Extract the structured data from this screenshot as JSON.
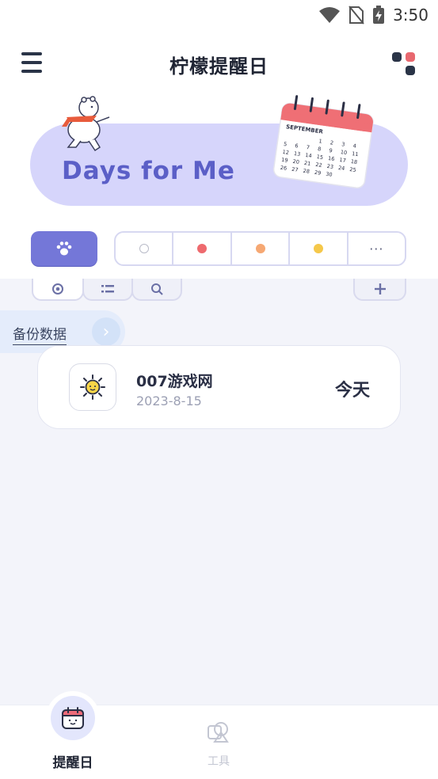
{
  "status_bar": {
    "time": "3:50"
  },
  "header": {
    "title": "柠檬提醒日"
  },
  "banner": {
    "text": "Days for Me",
    "calendar_month": "SEPTEMBER",
    "calendar_days": [
      "1",
      "2",
      "3",
      "4",
      "5",
      "6",
      "7",
      "8",
      "9",
      "10",
      "11",
      "12",
      "13",
      "14",
      "15",
      "16",
      "17",
      "18",
      "19",
      "20",
      "21",
      "22",
      "23",
      "24",
      "25",
      "26",
      "27",
      "28",
      "29",
      "30"
    ]
  },
  "filters": {
    "paw_icon": "paw-icon",
    "colors": [
      {
        "name": "all",
        "color": "#ffffff"
      },
      {
        "name": "red",
        "color": "#ee6a6e"
      },
      {
        "name": "orange",
        "color": "#f6a873"
      },
      {
        "name": "yellow",
        "color": "#f5c84a"
      }
    ],
    "more_label": "···"
  },
  "tabs": {
    "icons": [
      "target-icon",
      "list-icon",
      "search-icon",
      "plus-icon"
    ]
  },
  "backup": {
    "label": "备份数据",
    "arrow": "›"
  },
  "events": [
    {
      "title": "007游戏网",
      "date": "2023-8-15",
      "status": "今天",
      "icon": "sun-face-icon"
    }
  ],
  "bottom_nav": {
    "items": [
      {
        "label": "提醒日",
        "active": true,
        "icon": "calendar-face-icon"
      },
      {
        "label": "工具",
        "active": false,
        "icon": "tools-icon"
      }
    ]
  },
  "colors": {
    "accent": "#7477d8",
    "banner_bg": "#d6d5fb",
    "banner_text": "#5b5fc7",
    "content_bg": "#f3f4fa"
  }
}
